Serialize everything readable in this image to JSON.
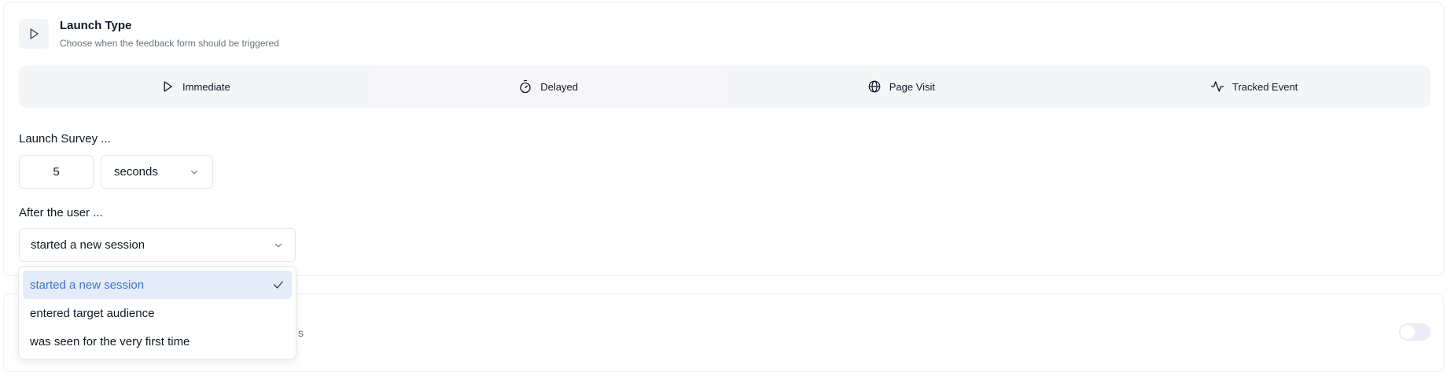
{
  "section": {
    "title": "Launch Type",
    "subtitle": "Choose when the feedback form should be triggered"
  },
  "tabs": [
    {
      "label": "Immediate",
      "icon": "play-icon"
    },
    {
      "label": "Delayed",
      "icon": "timer-icon",
      "active": true
    },
    {
      "label": "Page Visit",
      "icon": "globe-icon"
    },
    {
      "label": "Tracked Event",
      "icon": "activity-icon"
    }
  ],
  "launch": {
    "label": "Launch Survey ...",
    "delay_value": "5",
    "unit": "seconds"
  },
  "after": {
    "label": "After the user ...",
    "selected": "started a new session",
    "options": [
      {
        "label": "started a new session",
        "selected": true
      },
      {
        "label": "entered target audience"
      },
      {
        "label": "was seen for the very first time"
      }
    ]
  },
  "second_card": {
    "partial_text": "s"
  },
  "colors": {
    "accent": "#3b74c8",
    "selected_bg": "#e4ecfa",
    "tabbar_bg": "#f4f5f6",
    "toggle_bg": "#ececf8"
  }
}
